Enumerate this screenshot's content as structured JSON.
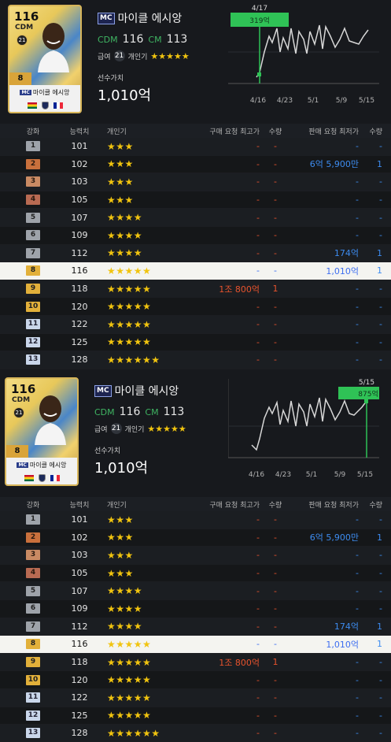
{
  "player": {
    "ovr": "116",
    "position_short": "CDM",
    "season_badge": "21",
    "level": "8",
    "mc_tag": "MC",
    "name": "마이클 에시앙",
    "pos1_label": "CDM",
    "pos1_value": "116",
    "pos2_label": "CM",
    "pos2_value": "113",
    "salary_label": "급여",
    "salary_value": "21",
    "reputation_label": "개인기",
    "reputation_stars": "★★★★★",
    "value_label": "선수가치",
    "value": "1,010억"
  },
  "panels": [
    {
      "chart": {
        "marker_date": "4/17",
        "marker_value": "319억",
        "x_ticks": [
          "4/16",
          "4/23",
          "5/1",
          "5/9",
          "5/15"
        ]
      }
    },
    {
      "chart": {
        "marker_date": "5/15",
        "marker_value": "875억",
        "x_ticks": [
          "4/16",
          "4/23",
          "5/1",
          "5/9",
          "5/15"
        ]
      }
    }
  ],
  "table": {
    "headers": {
      "grade": "강화",
      "ovr": "능력치",
      "stars": "개인기",
      "buy_price": "구매 요청 최고가",
      "buy_qty": "수량",
      "sell_price": "판매 요청 최저가",
      "sell_qty": "수량"
    },
    "rows": [
      {
        "grade": "1",
        "ovr": "101",
        "stars": "★★★",
        "buy_price": "-",
        "buy_qty": "-",
        "sell_price": "-",
        "sell_qty": "-"
      },
      {
        "grade": "2",
        "ovr": "102",
        "stars": "★★★",
        "buy_price": "-",
        "buy_qty": "-",
        "sell_price": "6억 5,900만",
        "sell_qty": "1"
      },
      {
        "grade": "3",
        "ovr": "103",
        "stars": "★★★",
        "buy_price": "-",
        "buy_qty": "-",
        "sell_price": "-",
        "sell_qty": "-"
      },
      {
        "grade": "4",
        "ovr": "105",
        "stars": "★★★",
        "buy_price": "-",
        "buy_qty": "-",
        "sell_price": "-",
        "sell_qty": "-"
      },
      {
        "grade": "5",
        "ovr": "107",
        "stars": "★★★★",
        "buy_price": "-",
        "buy_qty": "-",
        "sell_price": "-",
        "sell_qty": "-"
      },
      {
        "grade": "6",
        "ovr": "109",
        "stars": "★★★★",
        "buy_price": "-",
        "buy_qty": "-",
        "sell_price": "-",
        "sell_qty": "-"
      },
      {
        "grade": "7",
        "ovr": "112",
        "stars": "★★★★",
        "buy_price": "-",
        "buy_qty": "-",
        "sell_price": "174억",
        "sell_qty": "1"
      },
      {
        "grade": "8",
        "ovr": "116",
        "stars": "★★★★★",
        "buy_price": "-",
        "buy_qty": "-",
        "sell_price": "1,010억",
        "sell_qty": "1"
      },
      {
        "grade": "9",
        "ovr": "118",
        "stars": "★★★★★",
        "buy_price": "1조 800억",
        "buy_qty": "1",
        "sell_price": "-",
        "sell_qty": "-"
      },
      {
        "grade": "10",
        "ovr": "120",
        "stars": "★★★★★",
        "buy_price": "-",
        "buy_qty": "-",
        "sell_price": "-",
        "sell_qty": "-"
      },
      {
        "grade": "11",
        "ovr": "122",
        "stars": "★★★★★",
        "buy_price": "-",
        "buy_qty": "-",
        "sell_price": "-",
        "sell_qty": "-"
      },
      {
        "grade": "12",
        "ovr": "125",
        "stars": "★★★★★",
        "buy_price": "-",
        "buy_qty": "-",
        "sell_price": "-",
        "sell_qty": "-"
      },
      {
        "grade": "13",
        "ovr": "128",
        "stars": "★★★★★★",
        "buy_price": "-",
        "buy_qty": "-",
        "sell_price": "-",
        "sell_qty": "-"
      }
    ],
    "highlight_grade": "8"
  },
  "colors": {
    "accent_green": "#3fb462",
    "buy_red": "#e8532d",
    "sell_blue": "#3d8cf0",
    "star_gold": "#f1c40f"
  }
}
